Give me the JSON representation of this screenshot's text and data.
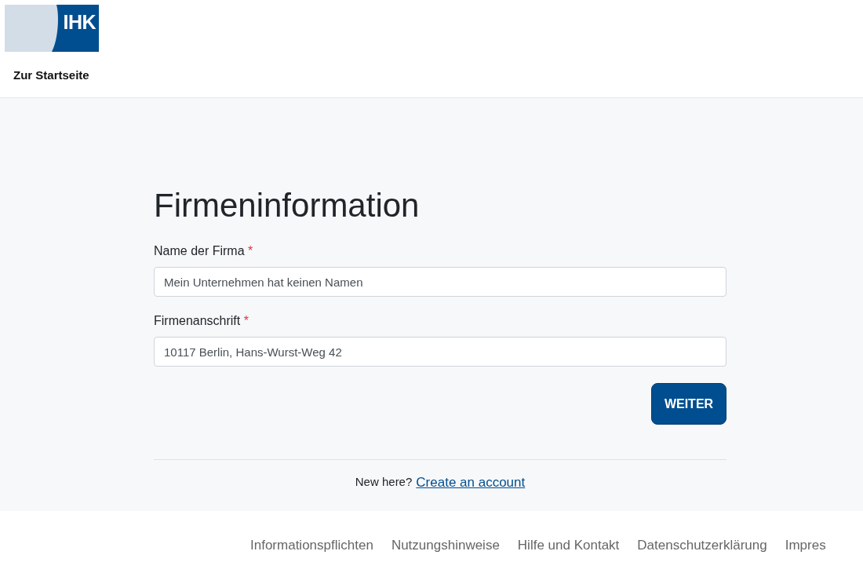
{
  "header": {
    "logo_text": "IHK",
    "home_link": "Zur Startseite"
  },
  "form": {
    "title": "Firmeninformation",
    "fields": [
      {
        "label": "Name der Firma",
        "required": true,
        "required_mark": "*",
        "value": "Mein Unternehmen hat keinen Namen"
      },
      {
        "label": "Firmenanschrift",
        "required": true,
        "required_mark": "*",
        "value": "10117 Berlin, Hans-Wurst-Weg 42"
      }
    ],
    "submit": "WEITER",
    "signup_prompt": "New here?",
    "signup_link": "Create an account"
  },
  "footer": {
    "links": [
      "Informationspflichten",
      "Nutzungshinweise",
      "Hilfe und Kontakt",
      "Datenschutzerklärung",
      "Impres"
    ]
  }
}
